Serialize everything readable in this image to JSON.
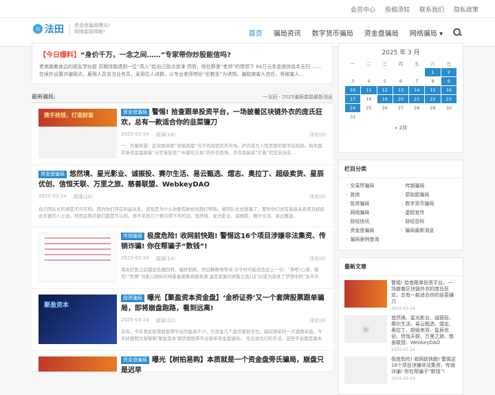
{
  "top_links": [
    "会员中心",
    "投稿须知",
    "联系我们",
    "隐私政策"
  ],
  "logo": {
    "mark": "◎",
    "text": "法田",
    "slogan1": "资金盘骗局曝光!",
    "slogan2": "网络套路揭秘!"
  },
  "nav": [
    "首页",
    "骗局资讯",
    "数字货币骗局",
    "资金盘骗局",
    "网络骗局 ▾"
  ],
  "notice": {
    "tag": "【今日爆料】",
    "title": "“身价千万，一念之间……”专家带你炒股能信吗?",
    "text": "老来跟着身边的朋友学炒股 并期待能遇到一位“高人”给自己指点迷津 然而，他在群里“老师”的带领下 64万元本金很快血本无归 …… 在境外设置诈骗窝点，雇用人员充当业务员，采用拉人进群，以专业老师带炒“伦教金”为诱饵，骗取被害人信任，将被害人..."
  },
  "latest": {
    "label": "最新骗局:",
    "right": "一法田 - 2025骗局套路最新消息"
  },
  "posts": [
    {
      "cat": "资金盘骗局",
      "title": "警惕! 拾查跟单投资平台，一场披着区块链外衣的庞氏狂欢，总有一款适合你的韭菜镰刀",
      "date": "2025-03-24",
      "views": "阅读(18)",
      "comments": "评论(0)",
      "excerpt": "一、诈骗背景：区块跟单即“收割凯旋”当下的加密货币市场，庐氏成为人性贪婪的数字化陷阱。每天都有新资金盘披着“元宇宙投资”“AI量化交易”的外衣登场，亦有伪装成“打着”社区自治名..."
    },
    {
      "cat": "资金盘骗局",
      "title": "悠然境、星光影业、诚振投、赛尔生活、易云甄选、熠志、奥拉丁、超级卖货、星辰优创、信恒天联、万里之旅、慈善联盟、WebkeyDAO",
      "date": "2025-03-24",
      "views": "阅读(10)",
      "comments": "评论(0)",
      "excerpt": "自己团队长的语是不可许的。因为你们存在利益关系，这就是为什么你更有粉丝找我们帮助。被团队长总想骗了，要听你们说有直接关系而且经经还丰富的人士说。然而这两点我们都是可以的。很不幸因几个要引得下市的话，悠然境、星光影业、诚振投、赛尔生活、易云甄选..."
    },
    {
      "cat": "传销骗局",
      "title": "极度危险! 收网前快跑! 警惕这16个项目涉嫌非法集资、传销诈骗! 你在帮骗子“数钱”!",
      "date": "2025-03-24",
      "views": "阅读(14)",
      "comments": "评论(0)",
      "excerpt": "海关打鱼之后都会告撤回转。骗好到新，然后静静地等待 对于时可能还会这上一句：“来吧!心满，缓坨!”世博“当鱼儿稍纵的纯卷备都像凋谢来源 温定紧案的拼集让鱼儿们以成为游进了梦想中的“鱼市天堂”殊不知出而到了涉关收网之日 在这个“全民共富”渊...",
      "thumb": "light"
    },
    {
      "cat": "投资骗局",
      "title": "曝光【聚盈资本资金盘】‘金桥证券’又一个套牌股票跟单骗局，即将崩盘跑路，看到远离!",
      "date": "2025-03-24",
      "views": "阅读(22)",
      "comments": "评论(0)",
      "excerpt": "去年。今年至此股票股套牌平台的盈高不少，万资金几个盘诈都很去也，越综跟单的一大波跑单盘。今天好朋和大家聊聊‘聚盈资本’期货股股票平台跟单资金盘骗局。 无论说也们的手法，这些平台都是基本一样，这一个团队供给的花招还加会的论功..."
    },
    {
      "cat": "资金盘骗局",
      "title": "曝光【树拍易购】本质就是一个资金盘旁氏骗局，崩盘只是迟早",
      "date": "",
      "views": "",
      "comments": "",
      "excerpt": ""
    }
  ],
  "calendar": {
    "title": "2025 年 3 月",
    "headers": [
      "一",
      "二",
      "三",
      "四",
      "五",
      "六",
      "日"
    ],
    "rows": [
      [
        "",
        "",
        "",
        "",
        "",
        "1",
        "2"
      ],
      [
        "3",
        "4",
        "5",
        "6",
        "7",
        "8",
        "9"
      ],
      [
        "10",
        "11",
        "12",
        "13",
        "14",
        "15",
        "16"
      ],
      [
        "17",
        "18",
        "19",
        "20",
        "21",
        "22",
        "23"
      ],
      [
        "24",
        "25",
        "26",
        "27",
        "28",
        "29",
        "30"
      ],
      [
        "31",
        "",
        "",
        "",
        "",
        "",
        ""
      ]
    ],
    "highlight": [
      "1",
      "2",
      "9",
      "10",
      "11",
      "12",
      "13",
      "14",
      "15",
      "16",
      "17",
      "19",
      "20",
      "21",
      "22",
      "23",
      "24"
    ],
    "prev": "« 2月"
  },
  "categories": {
    "title": "栏目分类",
    "items": [
      "交易所骗局",
      "传销骗局",
      "其他",
      "原始股骗局",
      "投资骗局",
      "数字货币骗局",
      "网络骗局",
      "虚假宣传",
      "财经快讯",
      "财经百科",
      "资金盘骗局",
      "骗局最新消息",
      "骗局案例查询"
    ]
  },
  "recent": {
    "title": "最新文章",
    "items": [
      {
        "text": "警惕! 拾查跟单投资平台，一场披着区块链外衣的庞氏狂欢，总有一款适合你的韭菜镰刀",
        "date": "2025-03-24",
        "thumb": "red"
      },
      {
        "text": "悠然境、星光影业、诚振投、赛尔生活、易云甄选、熠志、奥拉丁、超级卖货、星辰优创、信恒天联、万里之旅、慈善联盟、WebkeyDAO",
        "date": "2025-03-24",
        "thumb": "gray"
      },
      {
        "text": "极度危险! 收网前快跑! 警惕这16个项目涉嫌非法集资、传销诈骗! 你在帮骗子“数钱”!",
        "date": "2025-03-24",
        "thumb": "light"
      }
    ]
  }
}
